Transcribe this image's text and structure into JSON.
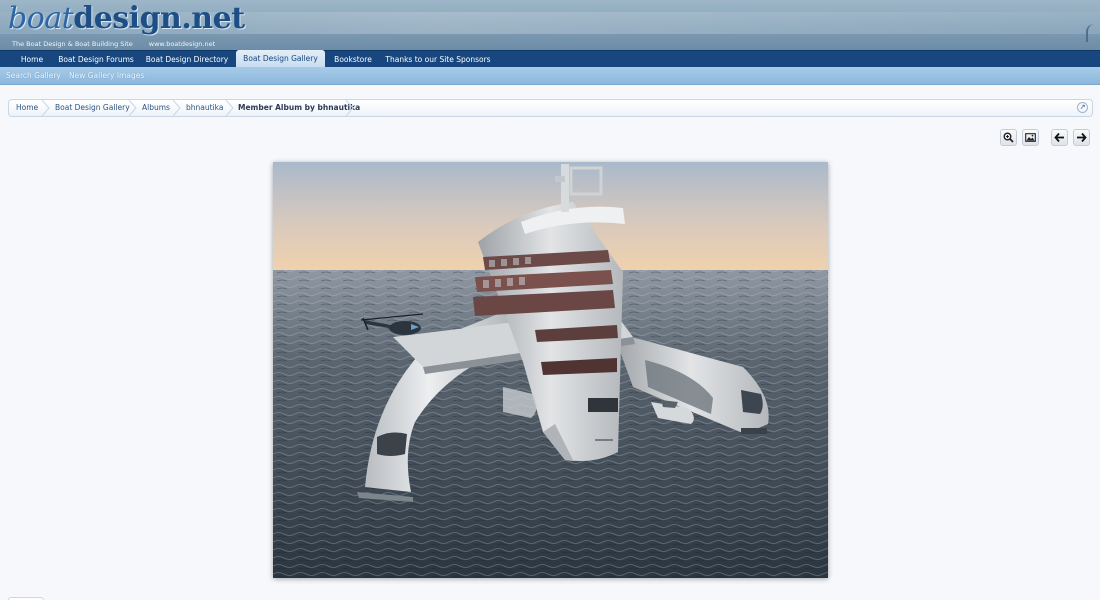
{
  "header": {
    "logo": {
      "prefix": "boat",
      "suffix": "design.net"
    },
    "tagline": "The Boat Design & Boat Building Site",
    "url_text": "www.boatdesign.net"
  },
  "nav": {
    "tabs": [
      {
        "label": "Home"
      },
      {
        "label": "Boat Design Forums"
      },
      {
        "label": "Boat Design Directory"
      },
      {
        "label": "Boat Design Gallery",
        "selected": true
      },
      {
        "label": "Bookstore"
      },
      {
        "label": "Thanks to our Site Sponsors"
      }
    ]
  },
  "subnav": {
    "links": [
      {
        "label": "Search Gallery"
      },
      {
        "label": "New Gallery Images"
      }
    ]
  },
  "breadcrumb": {
    "items": [
      {
        "label": "Home"
      },
      {
        "label": "Boat Design Gallery"
      },
      {
        "label": "Albums"
      },
      {
        "label": "bhnautika"
      },
      {
        "label": "Member Album by bhnautika",
        "current": true
      }
    ]
  },
  "toolbar": {
    "buttons": [
      {
        "icon": "zoom-in-icon"
      },
      {
        "icon": "image-icon"
      },
      {
        "icon": "arrow-left-icon"
      },
      {
        "icon": "arrow-right-icon"
      }
    ]
  },
  "image": {
    "subject": "render of a white multi-hull superyacht with a helicopter, on open sea at dusk"
  },
  "colors": {
    "nav_background": "#17477e",
    "subnav_background": "#9cc4e4",
    "link": "#2e5584",
    "page_background": "#f6f8fc"
  }
}
